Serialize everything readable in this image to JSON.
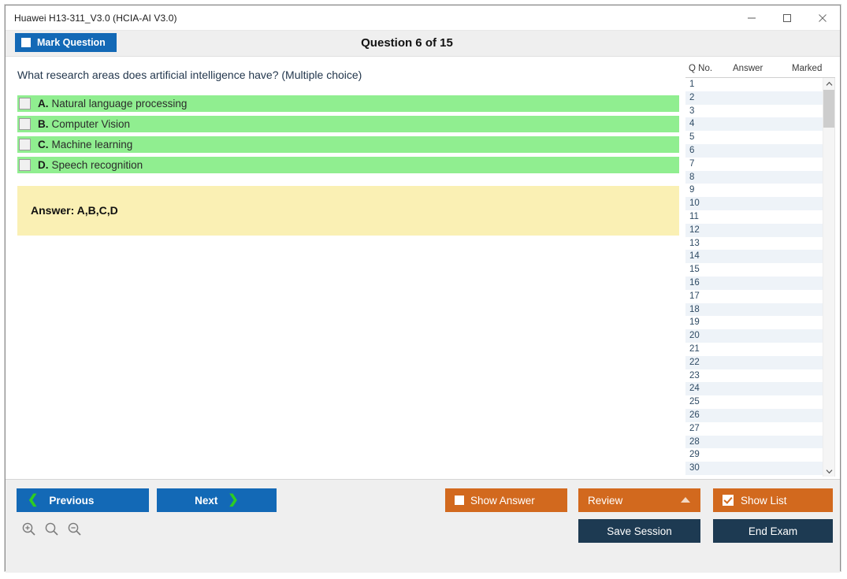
{
  "window": {
    "title": "Huawei H13-311_V3.0 (HCIA-AI V3.0)",
    "controls": {
      "minimize": "minimize-icon",
      "maximize": "maximize-icon",
      "close": "close-icon"
    }
  },
  "header": {
    "mark_question_label": "Mark Question",
    "mark_question_checked": false,
    "question_counter": "Question 6 of 15"
  },
  "question": {
    "prompt": "What research areas does artificial intelligence have? (Multiple choice)",
    "options": [
      {
        "letter": "A.",
        "text": "Natural language processing",
        "checked": false,
        "highlighted": true
      },
      {
        "letter": "B.",
        "text": "Computer Vision",
        "checked": false,
        "highlighted": true
      },
      {
        "letter": "C.",
        "text": "Machine learning",
        "checked": false,
        "highlighted": true
      },
      {
        "letter": "D.",
        "text": "Speech recognition",
        "checked": false,
        "highlighted": true
      }
    ],
    "answer_label": "Answer: A,B,C,D"
  },
  "question_list": {
    "columns": [
      "Q No.",
      "Answer",
      "Marked"
    ],
    "rows": [
      {
        "no": "1",
        "answer": "",
        "marked": ""
      },
      {
        "no": "2",
        "answer": "",
        "marked": ""
      },
      {
        "no": "3",
        "answer": "",
        "marked": ""
      },
      {
        "no": "4",
        "answer": "",
        "marked": ""
      },
      {
        "no": "5",
        "answer": "",
        "marked": ""
      },
      {
        "no": "6",
        "answer": "",
        "marked": ""
      },
      {
        "no": "7",
        "answer": "",
        "marked": ""
      },
      {
        "no": "8",
        "answer": "",
        "marked": ""
      },
      {
        "no": "9",
        "answer": "",
        "marked": ""
      },
      {
        "no": "10",
        "answer": "",
        "marked": ""
      },
      {
        "no": "11",
        "answer": "",
        "marked": ""
      },
      {
        "no": "12",
        "answer": "",
        "marked": ""
      },
      {
        "no": "13",
        "answer": "",
        "marked": ""
      },
      {
        "no": "14",
        "answer": "",
        "marked": ""
      },
      {
        "no": "15",
        "answer": "",
        "marked": ""
      },
      {
        "no": "16",
        "answer": "",
        "marked": ""
      },
      {
        "no": "17",
        "answer": "",
        "marked": ""
      },
      {
        "no": "18",
        "answer": "",
        "marked": ""
      },
      {
        "no": "19",
        "answer": "",
        "marked": ""
      },
      {
        "no": "20",
        "answer": "",
        "marked": ""
      },
      {
        "no": "21",
        "answer": "",
        "marked": ""
      },
      {
        "no": "22",
        "answer": "",
        "marked": ""
      },
      {
        "no": "23",
        "answer": "",
        "marked": ""
      },
      {
        "no": "24",
        "answer": "",
        "marked": ""
      },
      {
        "no": "25",
        "answer": "",
        "marked": ""
      },
      {
        "no": "26",
        "answer": "",
        "marked": ""
      },
      {
        "no": "27",
        "answer": "",
        "marked": ""
      },
      {
        "no": "28",
        "answer": "",
        "marked": ""
      },
      {
        "no": "29",
        "answer": "",
        "marked": ""
      },
      {
        "no": "30",
        "answer": "",
        "marked": ""
      }
    ]
  },
  "toolbar": {
    "previous_label": "Previous",
    "next_label": "Next",
    "show_answer_label": "Show Answer",
    "show_answer_checked": false,
    "review_label": "Review",
    "show_list_label": "Show List",
    "show_list_checked": true,
    "save_session_label": "Save Session",
    "end_exam_label": "End Exam",
    "zoom_in_icon": "zoom-in-icon",
    "zoom_reset_icon": "zoom-reset-icon",
    "zoom_out_icon": "zoom-out-icon"
  },
  "colors": {
    "primary_blue": "#1369b6",
    "accent_orange": "#d2691e",
    "dark_navy": "#1d3a52",
    "option_green": "#90ee90",
    "answer_yellow": "#faf0b4",
    "chevron_green": "#2ecc22"
  }
}
